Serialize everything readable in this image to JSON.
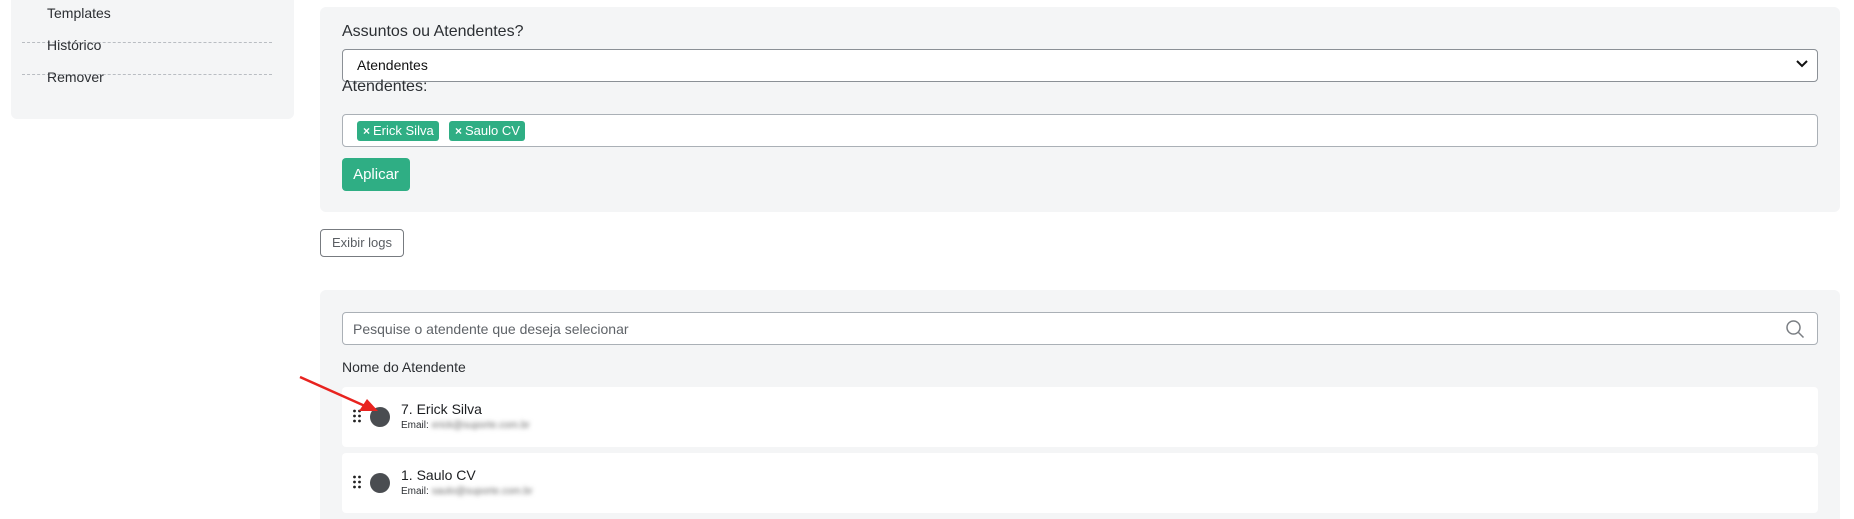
{
  "sidebar": {
    "items": [
      {
        "label": "Templates"
      },
      {
        "label": "Histórico"
      },
      {
        "label": "Remover"
      }
    ]
  },
  "filter": {
    "type_label": "Assuntos ou Atendentes?",
    "type_value": "Atendentes",
    "agents_label": "Atendentes:",
    "selected_tags": [
      "Erick Silva",
      "Saulo CV"
    ],
    "apply_label": "Aplicar"
  },
  "logs_button": "Exibir logs",
  "list": {
    "search_placeholder": "Pesquise o atendente que deseja selecionar",
    "column_header": "Nome do Atendente",
    "email_prefix": "Email:",
    "rows": [
      {
        "name": "7. Erick Silva",
        "email": "erick@suporte.com.br"
      },
      {
        "name": "1. Saulo CV",
        "email": "saulo@suporte.com.br"
      }
    ]
  },
  "colors": {
    "accent": "#2fae84",
    "panel_bg": "#f4f5f6",
    "annotation_arrow": "#e8231f"
  }
}
